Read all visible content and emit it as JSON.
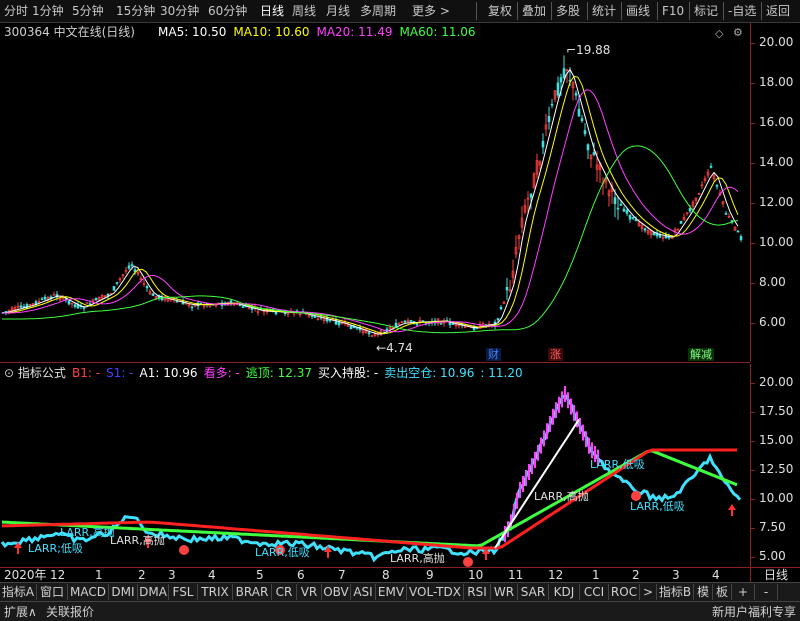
{
  "toolbar": {
    "left_items": [
      "分时",
      "1分钟",
      "5分钟",
      "15分钟",
      "30分钟",
      "60分钟",
      "日线",
      "周线",
      "月线",
      "多周期",
      "更多 >"
    ],
    "active": "日线",
    "right_items": [
      "复权",
      "叠加",
      "多股",
      "统计",
      "画线",
      "F10",
      "标记",
      "-自选",
      "返回"
    ]
  },
  "main": {
    "title": "300364 中文在线(日线)",
    "ma": [
      {
        "label": "MA5: 10.50",
        "color": "#ffffff"
      },
      {
        "label": "MA10: 10.60",
        "color": "#ffff00"
      },
      {
        "label": "MA20: 11.49",
        "color": "#ff40ff"
      },
      {
        "label": "MA60: 11.06",
        "color": "#40ff40"
      }
    ],
    "high_label": "19.88",
    "low_label": "4.74",
    "events": [
      {
        "text": "财",
        "color": "#4080ff",
        "bg": "#0a1a40"
      },
      {
        "text": "涨",
        "color": "#ff6060",
        "bg": "#400a0a"
      },
      {
        "text": "解减",
        "color": "#80ff80",
        "bg": "#0a300a"
      }
    ],
    "yaxis": [
      "20.00",
      "18.00",
      "16.00",
      "14.00",
      "12.00",
      "10.00",
      "8.00",
      "6.00"
    ]
  },
  "indicator": {
    "title": "指标公式",
    "legend": [
      {
        "label": "B1: -",
        "color": "#ff4040"
      },
      {
        "label": "S1: -",
        "color": "#4040ff"
      },
      {
        "label": "A1: 10.96",
        "color": "#ffffff"
      },
      {
        "label": "看多: -",
        "color": "#ff40ff"
      },
      {
        "label": "逃顶: 12.37",
        "color": "#40ff40"
      },
      {
        "label": "买入持股: -",
        "color": "#ffffff"
      },
      {
        "label": "卖出空仓: 10.96",
        "color": "#40e0ff"
      },
      {
        "label": ": 11.20",
        "color": "#40e0ff"
      }
    ],
    "annotations": {
      "low": "LARR,低吸",
      "high": "LARR,高抛",
      "short_low": "LARR;低吸"
    },
    "yaxis": [
      "20.00",
      "17.50",
      "15.00",
      "12.50",
      "10.00",
      "7.50",
      "5.00"
    ]
  },
  "months": [
    "2020年",
    "12",
    "1",
    "2",
    "3",
    "4",
    "5",
    "6",
    "7",
    "8",
    "9",
    "10",
    "11",
    "12",
    "1",
    "2",
    "3",
    "4"
  ],
  "period_label": "日线",
  "tabs": [
    "指标A",
    "窗口",
    "MACD",
    "DMI",
    "DMA",
    "FSL",
    "TRIX",
    "BRAR",
    "CR",
    "VR",
    "OBV",
    "ASI",
    "EMV",
    "VOL-TDX",
    "RSI",
    "WR",
    "SAR",
    "KDJ",
    "CCI",
    "ROC",
    ">",
    "指标B",
    "模",
    "板",
    "+",
    "-"
  ],
  "status": {
    "left1": "扩展∧",
    "left2": "关联报价",
    "right": "新用户福利专享"
  }
}
